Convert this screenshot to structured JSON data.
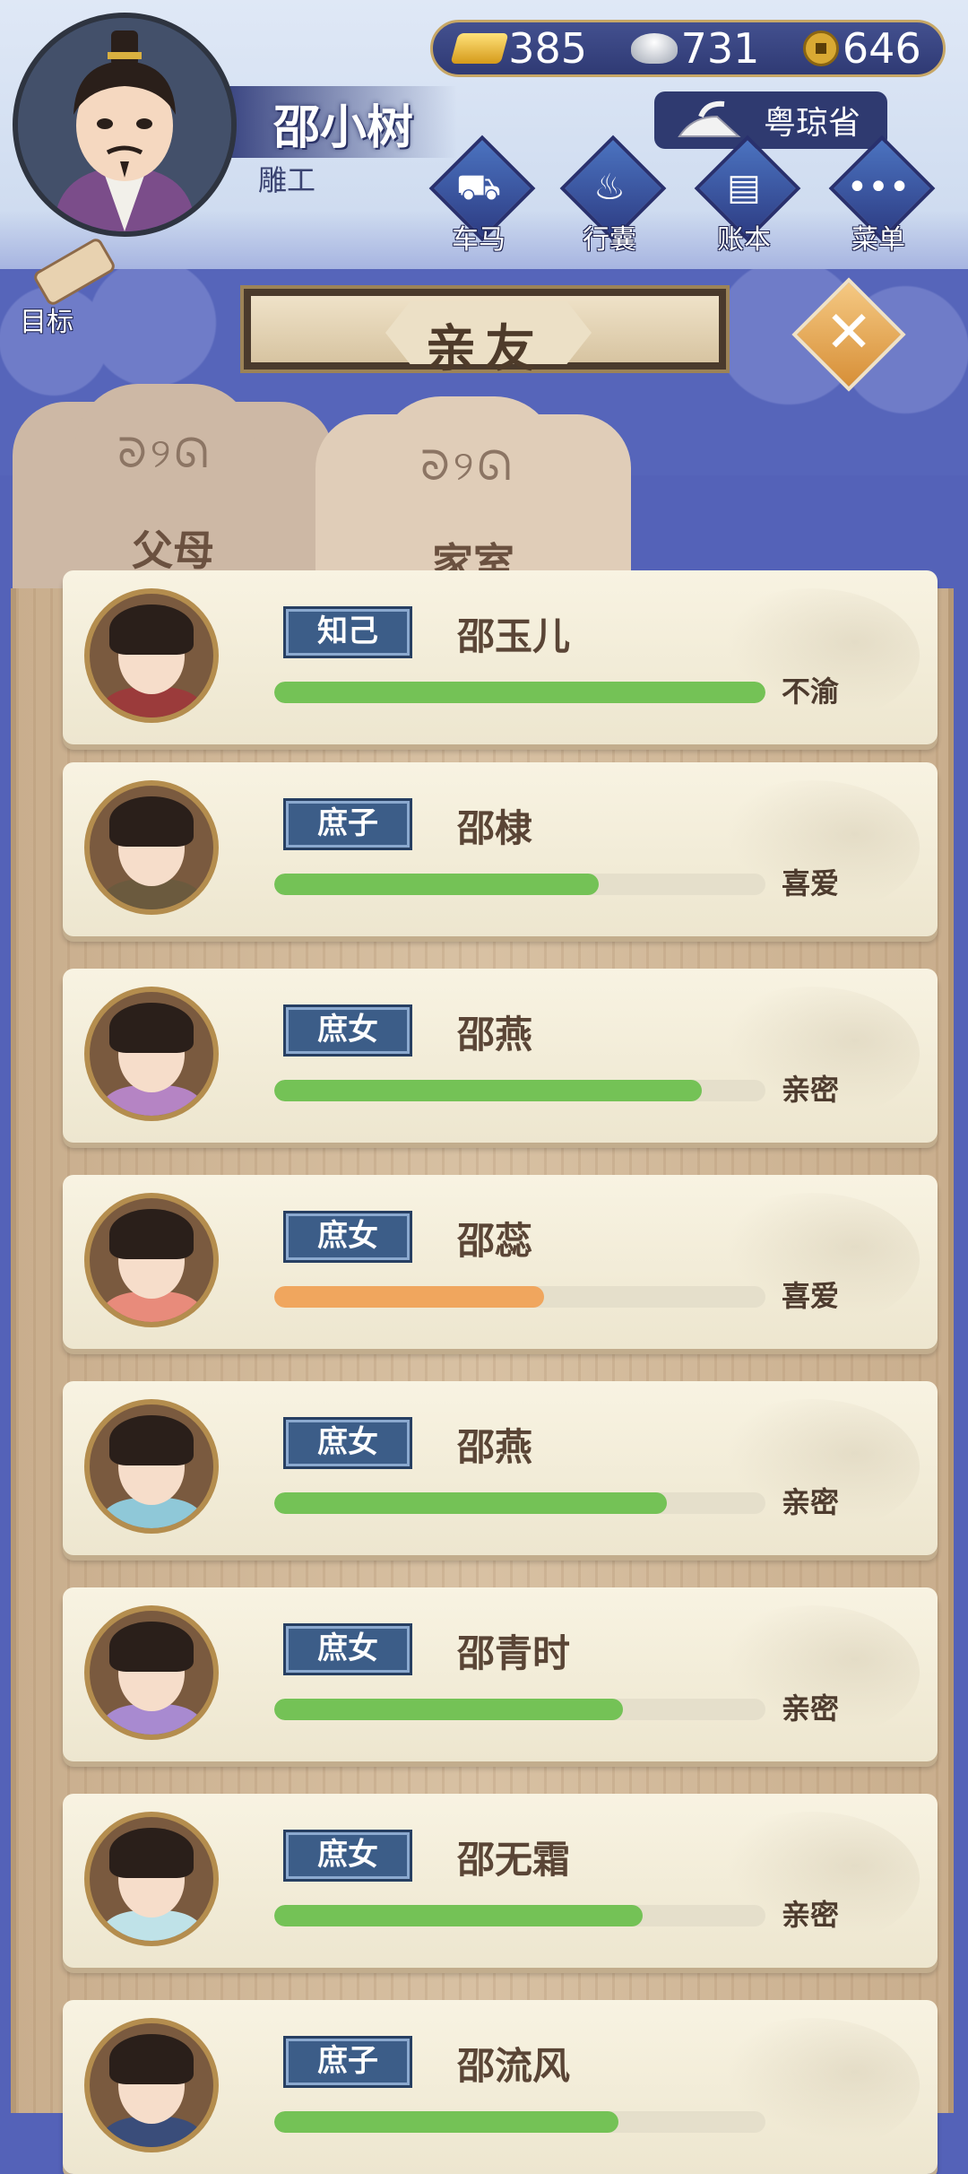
{
  "currency": [
    {
      "name": "gold-ingot-icon",
      "value": "385"
    },
    {
      "name": "silver-ingot-icon",
      "value": "731"
    },
    {
      "name": "copper-coin-icon",
      "value": "646"
    }
  ],
  "player": {
    "name": "邵小树",
    "title": "雕工",
    "province": "粤琼省"
  },
  "menu": [
    "车马",
    "行囊",
    "账本",
    "菜单"
  ],
  "goal_label": "目标",
  "page_title": "亲友",
  "tabs": [
    {
      "label": "父母",
      "active": false
    },
    {
      "label": "家室",
      "active": true
    }
  ],
  "colors": {
    "affection_green": "#74c256",
    "affection_orange": "#f0a65e",
    "badge_blue": "#3c5d88"
  },
  "relatives": [
    {
      "relation": "知己",
      "name": "邵玉儿",
      "affection": 1.0,
      "bar_color": "green",
      "status": "不渝",
      "robe": "#9b3b3b"
    },
    {
      "relation": "庶子",
      "name": "邵棣",
      "affection": 0.66,
      "bar_color": "green",
      "status": "喜爱",
      "robe": "#6b5a3e"
    },
    {
      "relation": "庶女",
      "name": "邵燕",
      "affection": 0.87,
      "bar_color": "green",
      "status": "亲密",
      "robe": "#b584c4"
    },
    {
      "relation": "庶女",
      "name": "邵蕊",
      "affection": 0.55,
      "bar_color": "orange",
      "status": "喜爱",
      "robe": "#e88b7b"
    },
    {
      "relation": "庶女",
      "name": "邵燕",
      "affection": 0.8,
      "bar_color": "green",
      "status": "亲密",
      "robe": "#8fc8d8"
    },
    {
      "relation": "庶女",
      "name": "邵青时",
      "affection": 0.71,
      "bar_color": "green",
      "status": "亲密",
      "robe": "#a88ad0"
    },
    {
      "relation": "庶女",
      "name": "邵无霜",
      "affection": 0.75,
      "bar_color": "green",
      "status": "亲密",
      "robe": "#bfe2e8"
    },
    {
      "relation": "庶子",
      "name": "邵流风",
      "affection": 0.7,
      "bar_color": "green",
      "status": "",
      "robe": "#3a4d7a"
    }
  ]
}
